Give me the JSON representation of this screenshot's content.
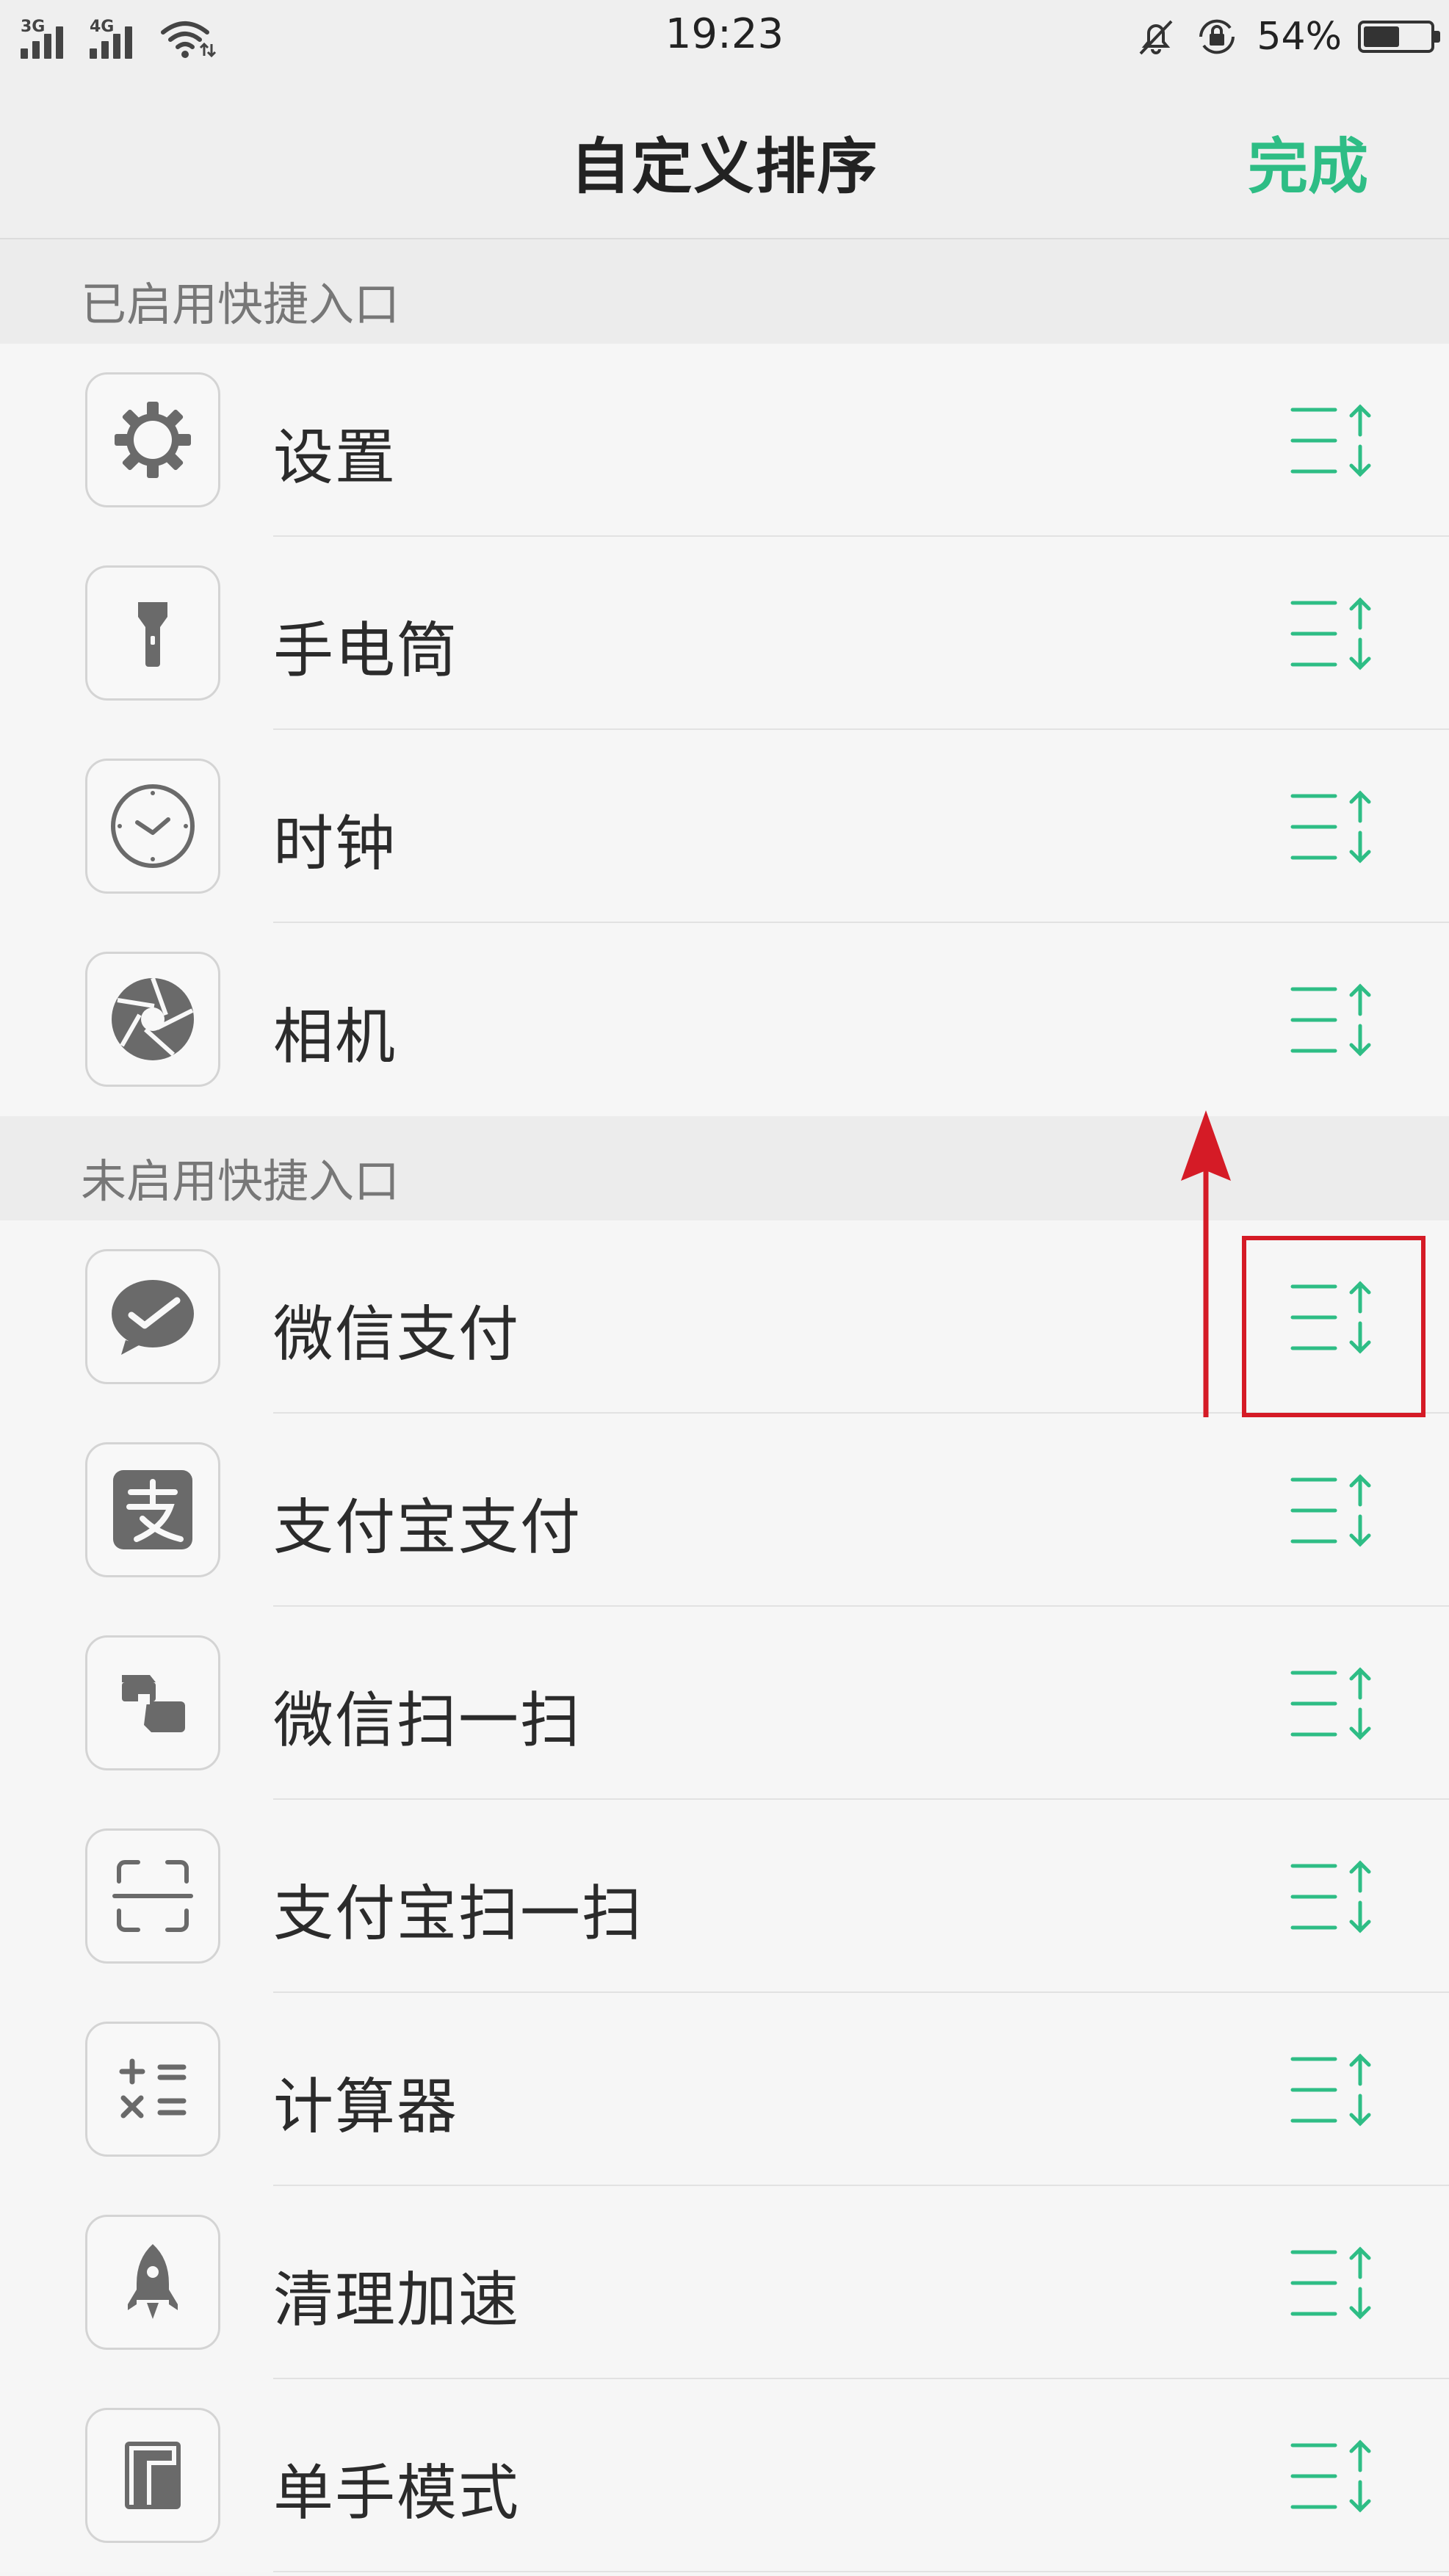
{
  "status_bar": {
    "signal_1": "3G",
    "signal_2": "4G",
    "time": "19:23",
    "battery": "54%",
    "battery_level": 0.54
  },
  "header": {
    "title": "自定义排序",
    "done_label": "完成",
    "accent_color": "#2ebd85"
  },
  "sections": [
    {
      "title": "已启用快捷入口",
      "items": [
        {
          "label": "设置",
          "icon": "gear-icon"
        },
        {
          "label": "手电筒",
          "icon": "flashlight-icon"
        },
        {
          "label": "时钟",
          "icon": "clock-icon"
        },
        {
          "label": "相机",
          "icon": "camera-aperture-icon"
        }
      ]
    },
    {
      "title": "未启用快捷入口",
      "items": [
        {
          "label": "微信支付",
          "icon": "wechat-pay-icon"
        },
        {
          "label": "支付宝支付",
          "icon": "alipay-icon"
        },
        {
          "label": "微信扫一扫",
          "icon": "wechat-scan-icon"
        },
        {
          "label": "支付宝扫一扫",
          "icon": "scan-frame-icon"
        },
        {
          "label": "计算器",
          "icon": "calculator-icon"
        },
        {
          "label": "清理加速",
          "icon": "rocket-icon"
        },
        {
          "label": "单手模式",
          "icon": "one-hand-mode-icon"
        }
      ]
    }
  ],
  "annotation": {
    "highlight_color": "#d51b26",
    "highlighted_item": "微信支付"
  }
}
